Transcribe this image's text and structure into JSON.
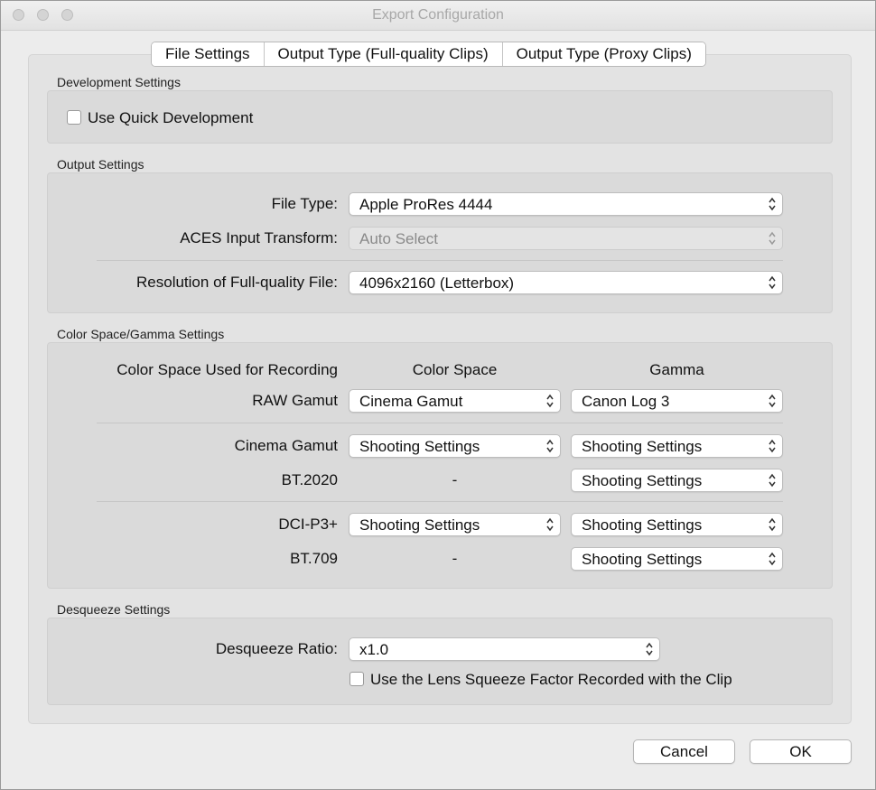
{
  "window": {
    "title": "Export Configuration"
  },
  "tabs": [
    {
      "label": "File Settings"
    },
    {
      "label": "Output Type (Full-quality Clips)"
    },
    {
      "label": "Output Type (Proxy Clips)"
    }
  ],
  "development": {
    "section_title": "Development Settings",
    "quick_dev_label": "Use Quick Development",
    "quick_dev_checked": false
  },
  "output": {
    "section_title": "Output Settings",
    "file_type_label": "File Type:",
    "file_type_value": "Apple ProRes 4444",
    "aces_label": "ACES Input Transform:",
    "aces_value": "Auto Select",
    "resolution_label": "Resolution of Full-quality File:",
    "resolution_value": "4096x2160 (Letterbox)"
  },
  "color": {
    "section_title": "Color Space/Gamma Settings",
    "header_recording": "Color Space Used for Recording",
    "header_color_space": "Color Space",
    "header_gamma": "Gamma",
    "rows": [
      {
        "label": "RAW Gamut",
        "color_space": "Cinema Gamut",
        "gamma": "Canon Log 3"
      },
      {
        "label": "Cinema Gamut",
        "color_space": "Shooting Settings",
        "gamma": "Shooting Settings"
      },
      {
        "label": "BT.2020",
        "color_space": "-",
        "gamma": "Shooting Settings"
      },
      {
        "label": "DCI-P3+",
        "color_space": "Shooting Settings",
        "gamma": "Shooting Settings"
      },
      {
        "label": "BT.709",
        "color_space": "-",
        "gamma": "Shooting Settings"
      }
    ]
  },
  "desqueeze": {
    "section_title": "Desqueeze Settings",
    "ratio_label": "Desqueeze Ratio:",
    "ratio_value": "x1.0",
    "lens_label": "Use the Lens Squeeze Factor Recorded with the Clip",
    "lens_checked": false
  },
  "buttons": {
    "cancel": "Cancel",
    "ok": "OK"
  }
}
